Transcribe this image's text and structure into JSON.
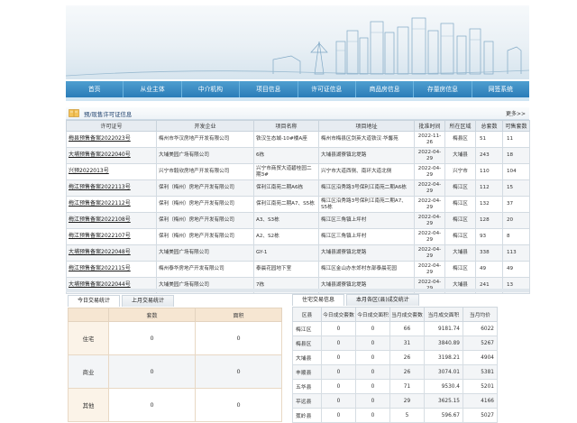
{
  "nav": [
    "首页",
    "从业主体",
    "中介机构",
    "项目信息",
    "许可证信息",
    "商品房信息",
    "存量房信息",
    "网签系统"
  ],
  "permit_section": {
    "title": "预/现售许可证信息",
    "more": "更多>>",
    "headers": [
      "许可证号",
      "开发企业",
      "项目名称",
      "项目地址",
      "批准时间",
      "所在区域",
      "总套数",
      "可售套数"
    ],
    "rows": [
      [
        "梅县预售备案2022023号",
        "梅州市华汉房地产开发有限公司",
        "铁汉生态城-10#楼A座",
        "梅州市梅县区剑英大道铁汉·华馨苑",
        "2022-11-26",
        "梅县区",
        "51",
        "11"
      ],
      [
        "大埔预售备案2022040号",
        "大埔美园广场有限公司",
        "6栋",
        "大埔县湖寮镇北堤路",
        "2022-04-29",
        "大埔县",
        "243",
        "18"
      ],
      [
        "兴预2022013号",
        "兴宁市毅欣房地产开发有限公司",
        "兴宁市商贸大道碧桂园二期3#",
        "兴宁市大道西侧、南环大道北侧",
        "2022-04-29",
        "兴宁市",
        "110",
        "104"
      ],
      [
        "梅江预售备案2022113号",
        "保利（梅州）房地产开发有限公司",
        "保利江南苑二期A6栋",
        "梅江区沿秀路3号保利江南苑二期A6栋",
        "2022-04-29",
        "梅江区",
        "112",
        "15"
      ],
      [
        "梅江预售备案2022112号",
        "保利（梅州）房地产开发有限公司",
        "保利江南苑二期A7、S5栋",
        "梅江区沿秀路3号保利江南苑二期A7、S5栋",
        "2022-04-29",
        "梅江区",
        "132",
        "37"
      ],
      [
        "梅江预售备案2022108号",
        "保利（梅州）房地产开发有限公司",
        "A3、S3栋",
        "梅江区三角镇上坪村",
        "2022-04-29",
        "梅江区",
        "128",
        "20"
      ],
      [
        "梅江预售备案2022107号",
        "保利（梅州）房地产开发有限公司",
        "A2、S2栋",
        "梅江区三角镇上坪村",
        "2022-04-29",
        "梅江区",
        "93",
        "8"
      ],
      [
        "大埔预售备案2022048号",
        "大埔美园广场有限公司",
        "GY-1",
        "大埔县湖寮镇北堤路",
        "2022-04-29",
        "大埔县",
        "338",
        "113"
      ],
      [
        "梅江预售备案2022115号",
        "梅州泰华房地产开发有限公司",
        "泰晨花园地下室",
        "梅江区金山办东郊村东部泰晨花园",
        "2022-04-29",
        "梅江区",
        "49",
        "49"
      ],
      [
        "大埔预售备案2022044号",
        "大埔美园广场有限公司",
        "7栋",
        "大埔县湖寮镇北堤路",
        "2022-04-29",
        "大埔县",
        "241",
        "13"
      ]
    ]
  },
  "daily": {
    "tabs": [
      "今日交易统计",
      "上月交易统计"
    ],
    "headers": [
      "",
      "套数",
      "面积"
    ],
    "rows": [
      [
        "住宅",
        "0",
        "0"
      ],
      [
        "商业",
        "0",
        "0"
      ],
      [
        "其他",
        "0",
        "0"
      ]
    ]
  },
  "monthly": {
    "tabs": [
      "住宅交易信息",
      "本月各区(县)成交统计"
    ],
    "headers": [
      "区县",
      "今日成交套数",
      "今日成交面积",
      "当月成交套数",
      "当月成交面积",
      "当月均价"
    ],
    "rows": [
      [
        "梅江区",
        "0",
        "0",
        "66",
        "9181.74",
        "6022"
      ],
      [
        "梅县区",
        "0",
        "0",
        "31",
        "3840.89",
        "5267"
      ],
      [
        "大埔县",
        "0",
        "0",
        "26",
        "3198.21",
        "4904"
      ],
      [
        "丰顺县",
        "0",
        "0",
        "26",
        "3074.01",
        "5381"
      ],
      [
        "五华县",
        "0",
        "0",
        "71",
        "9530.4",
        "5201"
      ],
      [
        "平远县",
        "0",
        "0",
        "29",
        "3625.15",
        "4166"
      ],
      [
        "蕉岭县",
        "0",
        "0",
        "5",
        "596.67",
        "5027"
      ]
    ]
  },
  "colors": {
    "nav": "#2a7cb8",
    "header_bg": "#e7ecf1",
    "daily_header": "#f6e6d2"
  }
}
